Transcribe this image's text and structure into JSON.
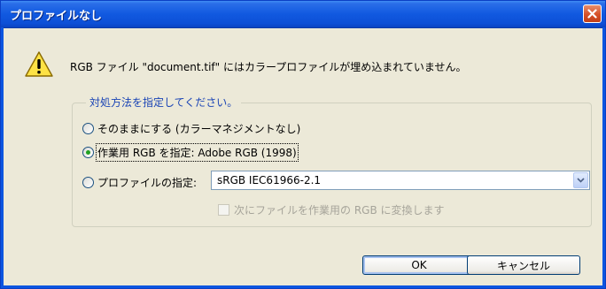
{
  "dialog": {
    "title": "プロファイルなし",
    "message": "RGB ファイル \"document.tif\" にはカラープロファイルが埋め込まれていません。"
  },
  "group": {
    "legend": "対処方法を指定してください。",
    "options": [
      {
        "label": "そのままにする (カラーマネジメントなし)",
        "checked": false
      },
      {
        "label": "作業用 RGB を指定: Adobe RGB (1998)",
        "checked": true
      },
      {
        "label": "プロファイルの指定:",
        "checked": false
      }
    ],
    "profile_dropdown_value": "sRGB IEC61966-2.1",
    "convert_checkbox_label": "次にファイルを作業用の RGB に変換します",
    "convert_checkbox_enabled": false
  },
  "buttons": {
    "ok": "OK",
    "cancel": "キャンセル"
  },
  "colors": {
    "titlebar": "#0d4fd6",
    "close_button": "#d65128",
    "legend_text": "#1a44b5",
    "window_bg": "#ece9d8"
  },
  "icons": [
    "warning-icon",
    "close-icon",
    "chevron-down-icon"
  ]
}
